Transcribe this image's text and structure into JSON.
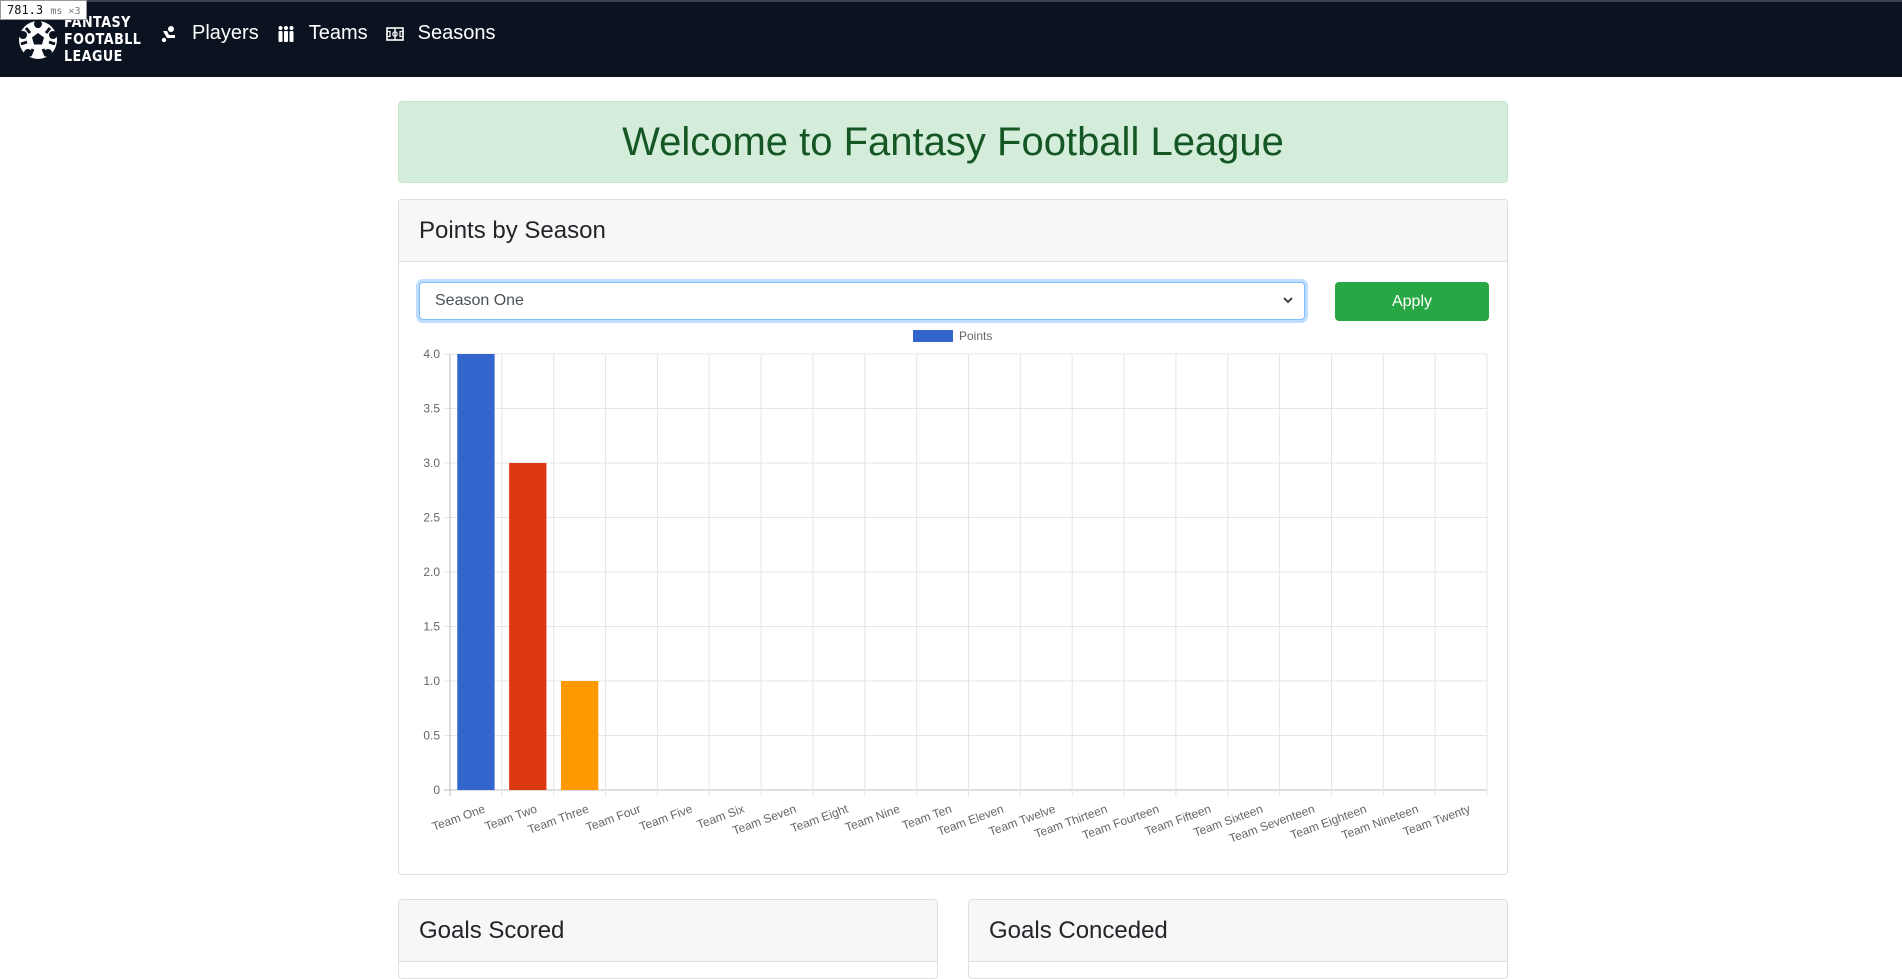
{
  "perf": {
    "value": "781.3",
    "unit": "ms ×3"
  },
  "brand": {
    "line1": "FANTASY",
    "line2": "FOOTABLL",
    "line3": "LEAGUE"
  },
  "nav": [
    {
      "label": "Players",
      "icon": "player-icon"
    },
    {
      "label": "Teams",
      "icon": "teams-icon"
    },
    {
      "label": "Seasons",
      "icon": "seasons-icon"
    }
  ],
  "welcome": "Welcome to Fantasy Football League",
  "points_card": {
    "title": "Points by Season",
    "select_value": "Season One",
    "apply_label": "Apply"
  },
  "goals_scored_title": "Goals Scored",
  "goals_conceded_title": "Goals Conceded",
  "chart_data": {
    "type": "bar",
    "legend_label": "Points",
    "legend_position": "top",
    "legend_color": "#3366cc",
    "categories": [
      "Team One",
      "Team Two",
      "Team Three",
      "Team Four",
      "Team Five",
      "Team Six",
      "Team Seven",
      "Team Eight",
      "Team Nine",
      "Team Ten",
      "Team Eleven",
      "Team Twelve",
      "Team Thirteen",
      "Team Fourteen",
      "Team Fifteen",
      "Team Sixteen",
      "Team Seventeen",
      "Team Eighteen",
      "Team Nineteen",
      "Team Twenty"
    ],
    "values": [
      4,
      3,
      1,
      0,
      0,
      0,
      0,
      0,
      0,
      0,
      0,
      0,
      0,
      0,
      0,
      0,
      0,
      0,
      0,
      0
    ],
    "colors": [
      "#3366cc",
      "#dc3912",
      "#ff9900"
    ],
    "yticks": [
      "0",
      "0.5",
      "1.0",
      "1.5",
      "2.0",
      "2.5",
      "3.0",
      "3.5",
      "4.0"
    ],
    "ylim": [
      0,
      4
    ],
    "grid": true
  }
}
